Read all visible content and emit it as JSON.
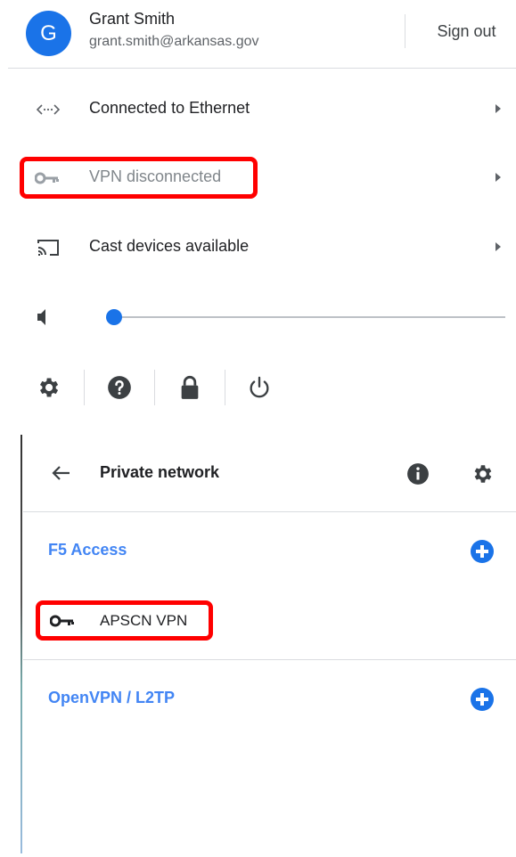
{
  "user": {
    "initial": "G",
    "name": "Grant Smith",
    "email": "grant.smith@arkansas.gov",
    "sign_out_label": "Sign out"
  },
  "menu": {
    "network_label": "Connected to Ethernet",
    "vpn_label": "VPN disconnected",
    "cast_label": "Cast devices available"
  },
  "volume": {
    "level": 0.02
  },
  "toolbar": {
    "icons": [
      "gear-icon",
      "help-icon",
      "lock-icon",
      "power-icon"
    ]
  },
  "private_network": {
    "title": "Private network",
    "sections": [
      {
        "label": "F5 Access",
        "items": [
          "APSCN VPN"
        ]
      },
      {
        "label": "OpenVPN / L2TP",
        "items": []
      }
    ]
  },
  "colors": {
    "accent": "#1a73e8",
    "section_text": "#4285f4",
    "highlight": "#ff0000"
  }
}
